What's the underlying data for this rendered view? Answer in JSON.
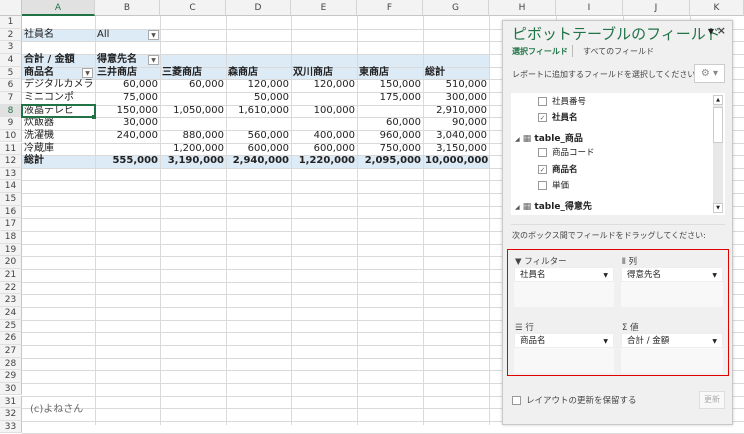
{
  "columns": [
    "A",
    "B",
    "C",
    "D",
    "E",
    "F",
    "G",
    "H",
    "I",
    "J",
    "K"
  ],
  "row_count": 33,
  "selected_cell": "A8",
  "filter": {
    "label": "社員名",
    "value": "All"
  },
  "pivot": {
    "value_label": "合計 / 金額",
    "col_field": "得意先名",
    "row_field": "商品名",
    "col_headers": [
      "三井商店",
      "三菱商店",
      "森商店",
      "双川商店",
      "東商店",
      "総計"
    ],
    "rows": [
      {
        "name": "デジタルカメラ",
        "values": [
          "60,000",
          "60,000",
          "120,000",
          "120,000",
          "150,000",
          "510,000"
        ]
      },
      {
        "name": "ミニコンポ",
        "values": [
          "75,000",
          "",
          "50,000",
          "",
          "175,000",
          "300,000"
        ]
      },
      {
        "name": "液晶テレビ",
        "values": [
          "150,000",
          "1,050,000",
          "1,610,000",
          "100,000",
          "",
          "2,910,000"
        ]
      },
      {
        "name": "炊飯器",
        "values": [
          "30,000",
          "",
          "",
          "",
          "60,000",
          "90,000"
        ]
      },
      {
        "name": "洗濯機",
        "values": [
          "240,000",
          "880,000",
          "560,000",
          "400,000",
          "960,000",
          "3,040,000"
        ]
      },
      {
        "name": "冷蔵庫",
        "values": [
          "",
          "1,200,000",
          "600,000",
          "600,000",
          "750,000",
          "3,150,000"
        ]
      }
    ],
    "total": {
      "name": "総計",
      "values": [
        "555,000",
        "3,190,000",
        "2,940,000",
        "1,220,000",
        "2,095,000",
        "10,000,000"
      ]
    }
  },
  "copyright": "(c)よねさん",
  "panel": {
    "title": "ピボットテーブルのフィールド",
    "tabs": [
      "選択フィールド",
      "すべてのフィールド"
    ],
    "description": "レポートに追加するフィールドを選択してください:",
    "fields": [
      {
        "label": "社員番号",
        "checked": false
      },
      {
        "label": "社員名",
        "checked": true
      }
    ],
    "tables": [
      {
        "name": "table_商品",
        "fields": [
          {
            "label": "商品コード",
            "checked": false
          },
          {
            "label": "商品名",
            "checked": true
          },
          {
            "label": "単価",
            "checked": false
          }
        ]
      },
      {
        "name": "table_得意先",
        "fields": []
      }
    ],
    "drag_hint": "次のボックス間でフィールドをドラッグしてください:",
    "areas": {
      "filter": {
        "label": "フィルター",
        "item": "社員名"
      },
      "columns": {
        "label": "列",
        "item": "得意先名"
      },
      "rows": {
        "label": "行",
        "item": "商品名"
      },
      "values": {
        "label": "値",
        "item": "合計 / 金額"
      }
    },
    "defer_label": "レイアウトの更新を保留する",
    "update_label": "更新"
  }
}
